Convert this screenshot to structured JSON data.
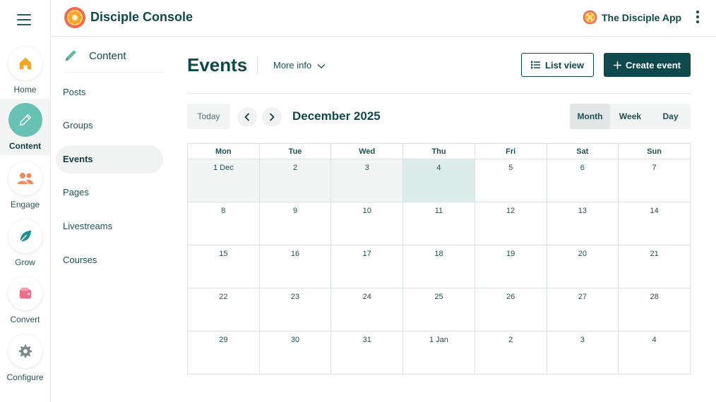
{
  "rail": {
    "items": [
      {
        "label": "Home",
        "icon": "home-icon"
      },
      {
        "label": "Content",
        "icon": "pencil-icon",
        "active": true
      },
      {
        "label": "Engage",
        "icon": "people-icon"
      },
      {
        "label": "Grow",
        "icon": "leaf-icon"
      },
      {
        "label": "Convert",
        "icon": "wallet-icon"
      },
      {
        "label": "Configure",
        "icon": "gear-icon"
      }
    ]
  },
  "header": {
    "console_title": "Disciple Console",
    "app_name": "The Disciple App"
  },
  "subnav": {
    "title": "Content",
    "items": [
      {
        "label": "Posts"
      },
      {
        "label": "Groups"
      },
      {
        "label": "Events",
        "active": true
      },
      {
        "label": "Pages"
      },
      {
        "label": "Livestreams"
      },
      {
        "label": "Courses"
      }
    ]
  },
  "main": {
    "title": "Events",
    "more_info": "More info",
    "list_view": "List view",
    "create_event": "Create event",
    "today": "Today",
    "month_label": "December 2025",
    "views": [
      "Month",
      "Week",
      "Day"
    ],
    "active_view": "Month"
  },
  "calendar": {
    "weekdays": [
      "Mon",
      "Tue",
      "Wed",
      "Thu",
      "Fri",
      "Sat",
      "Sun"
    ],
    "weeks": [
      [
        "1 Dec",
        "2",
        "3",
        "4",
        "5",
        "6",
        "7"
      ],
      [
        "8",
        "9",
        "10",
        "11",
        "12",
        "13",
        "14"
      ],
      [
        "15",
        "16",
        "17",
        "18",
        "19",
        "20",
        "21"
      ],
      [
        "22",
        "23",
        "24",
        "25",
        "26",
        "27",
        "28"
      ],
      [
        "29",
        "30",
        "31",
        "1 Jan",
        "2",
        "3",
        "4"
      ]
    ],
    "past_days": [
      "1 Dec",
      "2",
      "3"
    ],
    "today": "4"
  },
  "colors": {
    "primary": "#0e4a4d",
    "accent": "#67c2b4",
    "today_bg": "#dbecea"
  }
}
